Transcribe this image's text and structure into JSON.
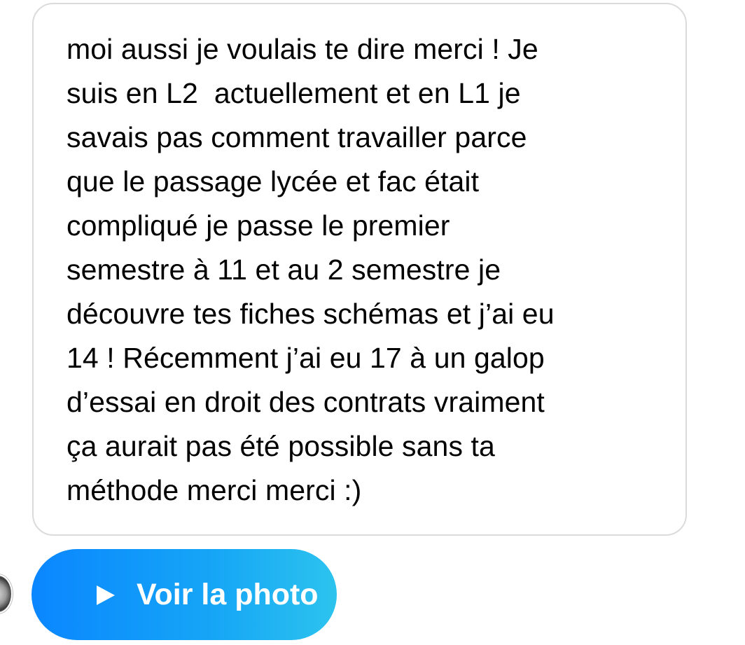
{
  "message": {
    "text": "moi aussi je voulais te dire merci ! Je\nsuis en L2  actuellement et en L1 je\nsavais pas comment travailler parce\nque le passage lycée et fac était\ncompliqué je passe le premier\nsemestre à 11 et au 2 semestre je\ndécouvre tes fiches schémas et j’ai eu\n14 ! Récemment j’ai eu 17 à un galop\nd’essai en droit des contrats vraiment\nça aurait pas été possible sans ta\nméthode merci merci :)"
  },
  "attachment": {
    "button_label": "Voir la photo",
    "icon": "play-icon",
    "gradient_colors": [
      "#0a86ff",
      "#2dc3ee"
    ]
  },
  "sender": {
    "avatar_icon": "avatar"
  }
}
